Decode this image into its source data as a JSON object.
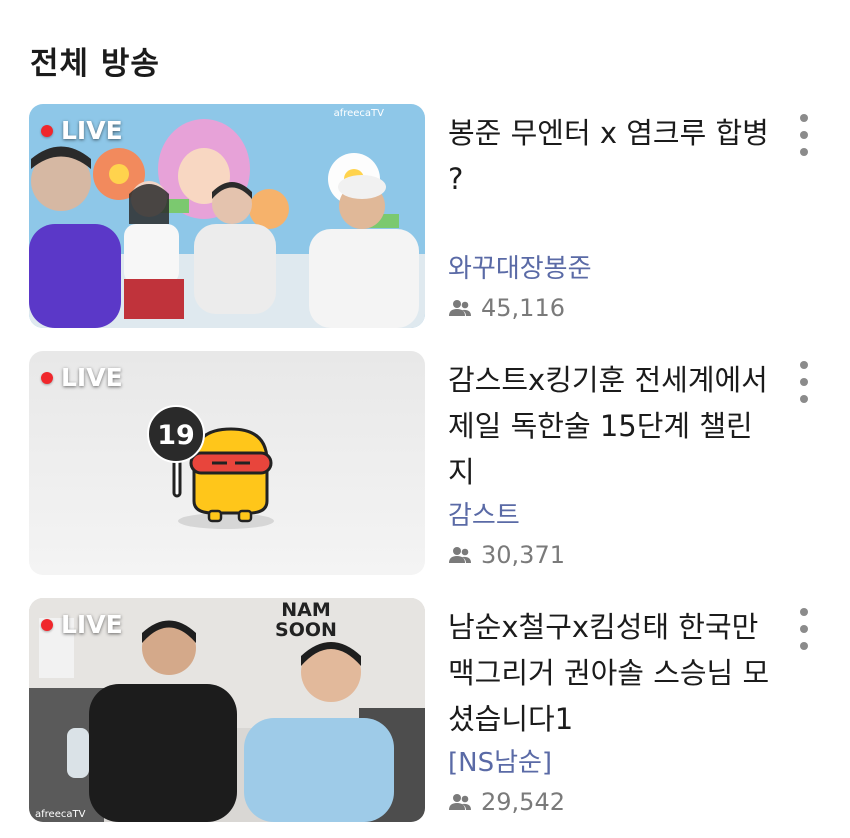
{
  "section": {
    "title": "전체 방송"
  },
  "broadcasts": [
    {
      "live_label": "LIVE",
      "title": "봉준 무엔터 x 염크루 합병 ?",
      "channel": "와꾸대장봉준",
      "viewers": "45,116",
      "watermark": "afreecaTV"
    },
    {
      "live_label": "LIVE",
      "title": "감스트x킹기훈 전세계에서 제일 독한술 15단계 챌린지",
      "channel": "감스트",
      "viewers": "30,371",
      "age_badge": "19"
    },
    {
      "live_label": "LIVE",
      "title": "남순x철구x킴성태 한국만 맥그리거 권아솔 스승님 모셨습니다1",
      "channel": "[NS남순]",
      "viewers": "29,542",
      "sign_line1": "NAM",
      "sign_line2": "SOON",
      "watermark": "afreecaTV"
    }
  ],
  "colors": {
    "live_dot": "#f0272c",
    "channel_text": "#5a6aa6",
    "meta_text": "#7a7a7a",
    "more_dots": "#8b8b8b"
  },
  "icons": [
    "users-icon",
    "more-vertical-icon",
    "live-dot-icon"
  ]
}
